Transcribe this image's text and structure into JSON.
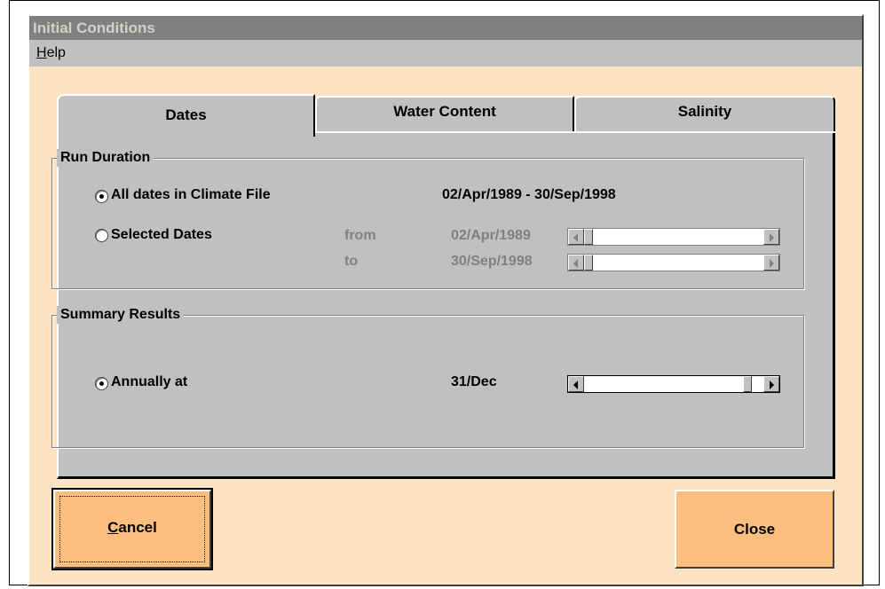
{
  "window": {
    "title": "Initial Conditions",
    "menu": {
      "help_prefix": "H",
      "help_rest": "elp"
    }
  },
  "tabs": [
    {
      "label": "Dates",
      "selected": true
    },
    {
      "label": "Water Content",
      "selected": false
    },
    {
      "label": "Salinity",
      "selected": false
    }
  ],
  "run_duration": {
    "group_label": "Run Duration",
    "all_dates": {
      "label": "All dates in Climate File",
      "selected": true,
      "value": "02/Apr/1989 - 30/Sep/1998"
    },
    "selected_dates": {
      "label": "Selected Dates",
      "selected": false,
      "from_label": "from",
      "from_value": "02/Apr/1989",
      "to_label": "to",
      "to_value": "30/Sep/1998"
    }
  },
  "summary_results": {
    "group_label": "Summary Results",
    "annually": {
      "label": "Annually at",
      "selected": true,
      "value": "31/Dec"
    }
  },
  "buttons": {
    "cancel_prefix": "C",
    "cancel_rest": "ancel",
    "close_label": "Close"
  },
  "colors": {
    "window_bg": "#fde2c4",
    "button_bg": "#fdbe7f",
    "panel_bg": "#c0c0c0",
    "title_bg": "#808080"
  }
}
